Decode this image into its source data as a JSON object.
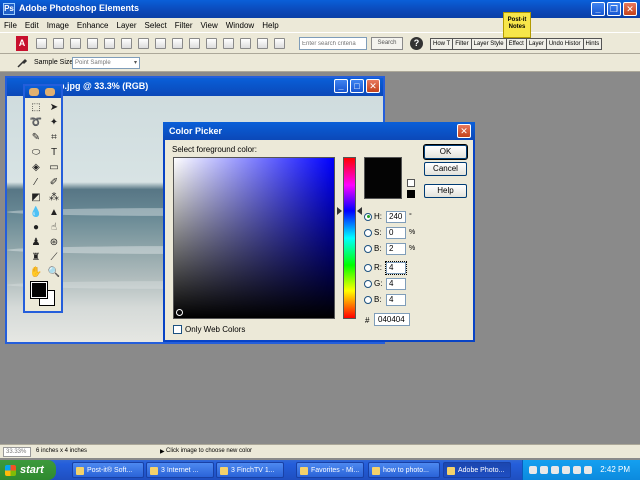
{
  "app": {
    "title": "Adobe Photoshop Elements"
  },
  "menu": [
    "File",
    "Edit",
    "Image",
    "Enhance",
    "Layer",
    "Select",
    "Filter",
    "View",
    "Window",
    "Help"
  ],
  "shortcuts": {
    "search_placeholder": "Enter search criteria",
    "search_button": "Search",
    "help_icon": "?",
    "logo": "A"
  },
  "palette_well": [
    "How T",
    "Filter",
    "Layer Style",
    "Effect",
    "Layer",
    "Undo Histor",
    "Hints"
  ],
  "postit": {
    "line1": "Post-it",
    "line2": "Notes"
  },
  "options_bar": {
    "label": "Sample Size:",
    "value": "Point Sample"
  },
  "document": {
    "title": "crop.jpg @ 33.3% (RGB)"
  },
  "color_picker": {
    "title": "Color Picker",
    "prompt": "Select foreground color:",
    "ok": "OK",
    "cancel": "Cancel",
    "help": "Help",
    "fields": {
      "h": {
        "label": "H:",
        "value": "240",
        "unit": "°"
      },
      "s": {
        "label": "S:",
        "value": "0",
        "unit": "%"
      },
      "b": {
        "label": "B:",
        "value": "2",
        "unit": "%"
      },
      "r": {
        "label": "R:",
        "value": "4",
        "unit": ""
      },
      "g": {
        "label": "G:",
        "value": "4",
        "unit": ""
      },
      "bl": {
        "label": "B:",
        "value": "4",
        "unit": ""
      }
    },
    "hex_label": "#",
    "hex": "040404",
    "web_only": "Only Web Colors",
    "current_color": "#040404"
  },
  "statusbar": {
    "zoom": "33.33%",
    "doc_size": "6 inches x 4 inches",
    "message": "Click image to choose new color"
  },
  "taskbar": {
    "start": "start",
    "tasks": [
      "Post-it® Soft...",
      "3 Internet ...",
      "3 FinchTV 1...",
      "Favorites - Mi...",
      "how to photo...",
      "Adobe Photo..."
    ],
    "clock": "2:42 PM"
  }
}
